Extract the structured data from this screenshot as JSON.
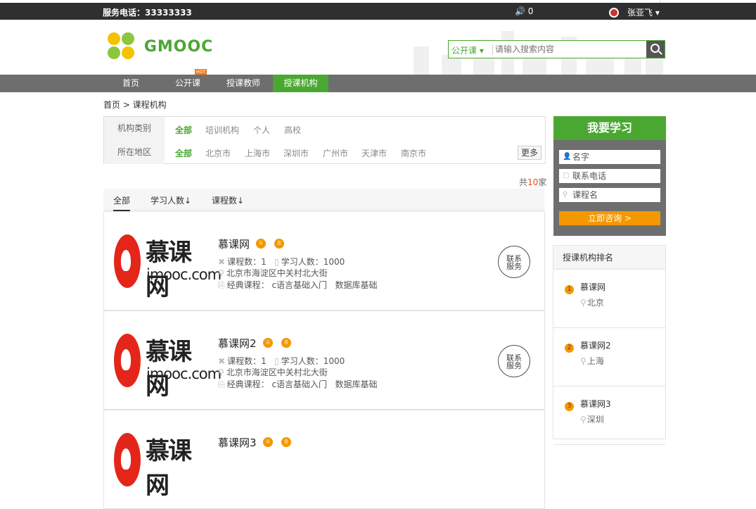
{
  "topbar": {
    "phone": "服务电话：33333333",
    "messages": "🔊 0",
    "user": "张亚飞 ▾"
  },
  "logo": {
    "text": "GMOOC"
  },
  "search": {
    "category": "公开课 ▾",
    "placeholder": "请输入搜索内容"
  },
  "nav": {
    "items": [
      "首页",
      "公开课",
      "授课教师",
      "授课机构"
    ],
    "active": "授课机构",
    "hot_label": "HOT"
  },
  "breadcrumb": "首页 > 课程机构",
  "filter": {
    "type_label": "机构类别",
    "type_options": [
      "全部",
      "培训机构",
      "个人",
      "高校"
    ],
    "region_label": "所在地区",
    "region_options": [
      "全部",
      "北京市",
      "上海市",
      "深圳市",
      "广州市",
      "天津市",
      "南京市"
    ],
    "more_label": "更多"
  },
  "total": {
    "prefix": "共",
    "count": "10",
    "suffix": "家"
  },
  "sort": {
    "options": [
      "全部",
      "学习人数↓",
      "课程数↓"
    ]
  },
  "orgs": [
    {
      "name": "慕课网",
      "course_count": "课程数：1",
      "learner_count": "学习人数：1000",
      "address": "北京市海淀区中关村北大街",
      "classic": "经典课程：",
      "course1": "c语言基础入门",
      "course2": "数据库基础"
    },
    {
      "name": "慕课网2",
      "course_count": "课程数：1",
      "learner_count": "学习人数：1000",
      "address": "北京市海淀区中关村北大街",
      "classic": "经典课程：",
      "course1": "c语言基础入门",
      "course2": "数据库基础"
    },
    {
      "name": "慕课网3"
    }
  ],
  "org_logo": {
    "cn": "慕课网",
    "en": "imooc.com"
  },
  "badges": {
    "cert": "认",
    "gold": "金"
  },
  "contact_label_1": "联系",
  "contact_label_2": "服务",
  "learn": {
    "title": "我要学习",
    "name_placeholder": "名字",
    "phone_placeholder": "联系电话",
    "course_placeholder": "课程名",
    "submit": "立即咨询 >"
  },
  "rank": {
    "title": "授课机构排名",
    "items": [
      {
        "no": "1",
        "name": "慕课网",
        "city": "北京"
      },
      {
        "no": "2",
        "name": "慕课网2",
        "city": "上海"
      },
      {
        "no": "3",
        "name": "慕课网3",
        "city": "深圳"
      }
    ]
  },
  "colors": {
    "brand_green": "#4aa832",
    "nav_gray": "#6e6e6e",
    "accent_orange": "#f39800",
    "logo_red": "#e4261a"
  }
}
